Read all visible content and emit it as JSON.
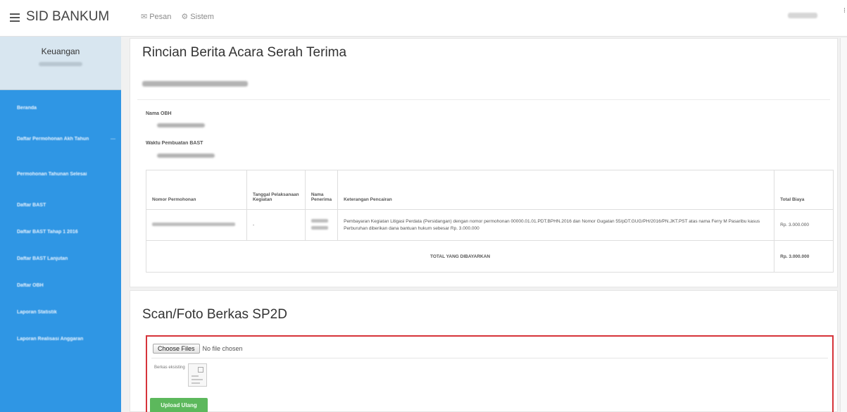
{
  "app": {
    "title": "SID BANKUM"
  },
  "topnav": [
    {
      "icon": "envelope-icon",
      "glyph": "✉",
      "label": "Pesan"
    },
    {
      "icon": "gear-icon",
      "glyph": "⚙",
      "label": "Sistem"
    }
  ],
  "sidebar": {
    "title": "Keuangan",
    "items": [
      {
        "label": "Beranda"
      },
      {
        "label": "Daftar Permohonan Akh Tahun",
        "suffix": "—"
      },
      {
        "label": "Permohonan Tahunan Selesai"
      },
      {
        "label": "Daftar BAST"
      },
      {
        "label": "Daftar BAST Tahap 1 2016"
      },
      {
        "label": "Daftar BAST Lanjutan"
      },
      {
        "label": "Daftar OBH"
      },
      {
        "label": "Laporan Statistik"
      },
      {
        "label": "Laporan Realisasi Anggaran"
      }
    ]
  },
  "rincian": {
    "heading": "Rincian Berita Acara Serah Terima",
    "field1_label": "Nama OBH",
    "field2_label": "Waktu Pembuatan BAST",
    "table": {
      "headers": [
        "Nomor Permohonan",
        "Tanggal Pelaksanaan Kegiatan",
        "Nama Penerima",
        "Keterangan Pencairan",
        "Total Biaya"
      ],
      "row": {
        "tanggal": "-",
        "keterangan": "Pembayaran Kegiatan Litigasi Perdata (Persidangan) dengan nomor permohonan 00000.01.01.PDT.BPHN.2016 dan Nomor Gugatan 55/pDT.GUG/PH/2016/PN.JKT.PST atas nama Ferry M Pasaribu kasus Perburuhan diberikan dana bantuan hukum sebesar Rp. 3.000.000",
        "biaya": "Rp. 3.000.000"
      },
      "total_label": "TOTAL YANG DIBAYARKAN",
      "total_value": "Rp. 3.000.000"
    }
  },
  "scan": {
    "heading": "Scan/Foto Berkas SP2D",
    "choose_label": "Choose Files",
    "nofile_text": "No file chosen",
    "preview_label": "Berkas eksisting",
    "upload_label": "Upload Ulang"
  },
  "colors": {
    "sidebar": "#2f96e4",
    "upload_border": "#d6343a",
    "upload_button": "#5cb85c"
  }
}
